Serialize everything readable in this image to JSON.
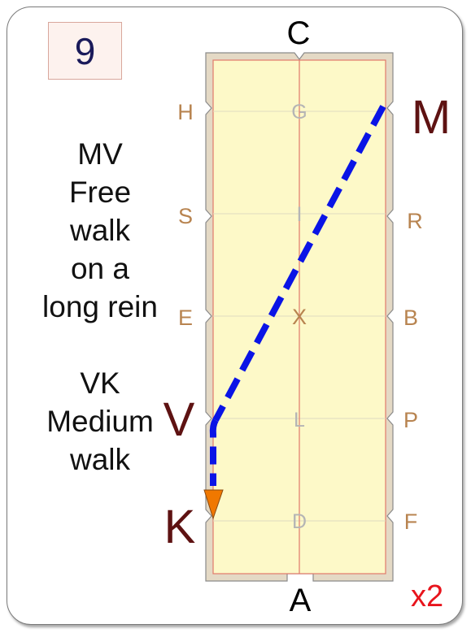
{
  "test_number": "9",
  "multiplier": "x2",
  "movements": [
    {
      "lines": [
        "MV",
        "Free",
        "walk",
        "on a",
        "long rein"
      ]
    },
    {
      "lines": [
        "VK",
        "Medium",
        "walk"
      ]
    }
  ],
  "letters": {
    "top": "C",
    "bottom": "A",
    "left": [
      "H",
      "S",
      "E"
    ],
    "right": [
      "R",
      "B",
      "P",
      "F"
    ],
    "centerline": [
      "G",
      "I",
      "X",
      "L",
      "D"
    ],
    "highlight": [
      "M",
      "V",
      "K"
    ]
  },
  "colors": {
    "arena_fill": "#fdf9c8",
    "arena_border": "#e0d5c3",
    "inner_line": "#e07a6a",
    "path": "#0a14e6",
    "arrow": "#f07800",
    "highlight_letter": "#5e1212",
    "marker_letter": "#b88450",
    "centerline_letter": "#b5b5b5"
  }
}
